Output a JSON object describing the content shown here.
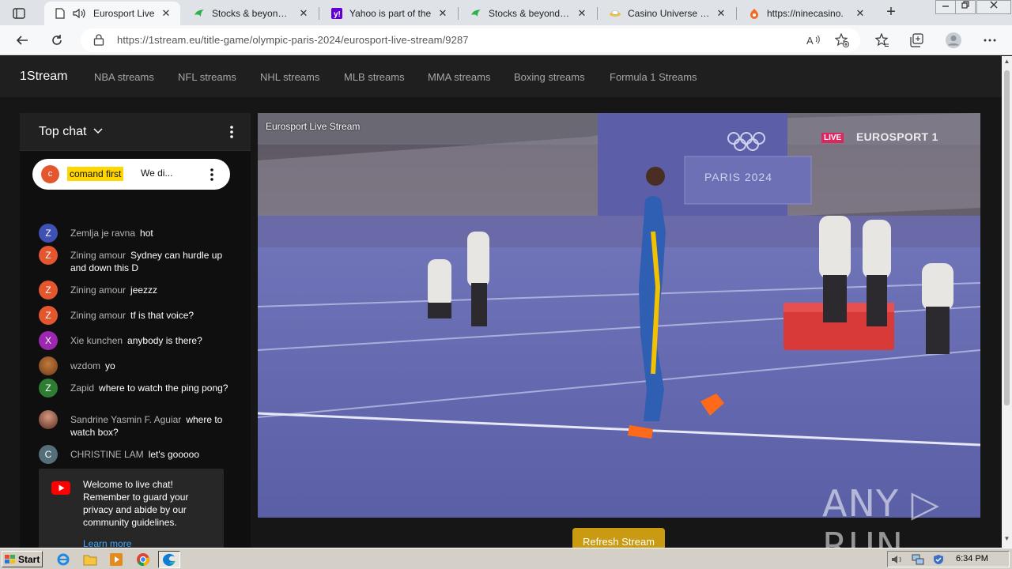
{
  "browser": {
    "tabs": [
      {
        "title": "Eurosport Live",
        "icon": "page-icon",
        "active": true
      },
      {
        "title": "Stocks & beyond: Ir",
        "icon": "stocks-favicon"
      },
      {
        "title": "Yahoo is part of the",
        "icon": "yahoo-favicon"
      },
      {
        "title": "Stocks & beyond: Ir",
        "icon": "stocks-favicon"
      },
      {
        "title": "Casino Universe Ca",
        "icon": "casino-favicon"
      },
      {
        "title": "https://ninecasino.",
        "icon": "ninecasino-favicon"
      }
    ],
    "close_glyph": "✕",
    "new_tab_glyph": "+",
    "url": "https://1stream.eu/title-game/olympic-paris-2024/eurosport-live-stream/9287"
  },
  "site": {
    "brand": "1Stream",
    "nav": [
      "NBA streams",
      "NFL streams",
      "NHL streams",
      "MLB streams",
      "MMA streams",
      "Boxing streams",
      "Formula 1 Streams"
    ]
  },
  "chat": {
    "header": "Top chat",
    "pinned": {
      "initial": "c",
      "author": "comand first",
      "text": "We di..."
    },
    "messages": [
      {
        "initial": "Z",
        "author": "Zemlja je ravna",
        "text": "hot",
        "color": "#3f51b5"
      },
      {
        "initial": "Z",
        "author": "Zining amour",
        "text": "Sydney can hurdle up and down this D",
        "color": "#e4572e"
      },
      {
        "initial": "Z",
        "author": "Zining amour",
        "text": "jeezzz",
        "color": "#e4572e"
      },
      {
        "initial": "Z",
        "author": "Zining amour",
        "text": "tf is that voice?",
        "color": "#e4572e"
      },
      {
        "initial": "X",
        "author": "Xie kunchen",
        "text": "anybody is there?",
        "color": "#9c27b0"
      },
      {
        "initial": "",
        "author": "wzdom",
        "text": "yo",
        "color": "#8a5a3c"
      },
      {
        "initial": "Z",
        "author": "Zapid",
        "text": "where to watch the ping pong?",
        "color": "#2e7d32"
      },
      {
        "initial": "",
        "author": "Sandrine Yasmin F. Aguiar",
        "text": "where to watch box?",
        "color": "#7a3b2e"
      },
      {
        "initial": "C",
        "author": "CHRISTINE LAM",
        "text": "let's gooooo",
        "color": "#546e7a"
      }
    ],
    "welcome": {
      "text": "Welcome to live chat! Remember to guard your privacy and abide by our community guidelines.",
      "link": "Learn more"
    }
  },
  "player": {
    "title": "Eurosport Live Stream",
    "live": "LIVE",
    "channel": "EUROSPORT 1",
    "banner": "PARIS 2024"
  },
  "refresh_label": "Refresh Stream",
  "watermark": "ANY ▷ RUN",
  "taskbar": {
    "start": "Start",
    "clock": "6:34 PM"
  }
}
